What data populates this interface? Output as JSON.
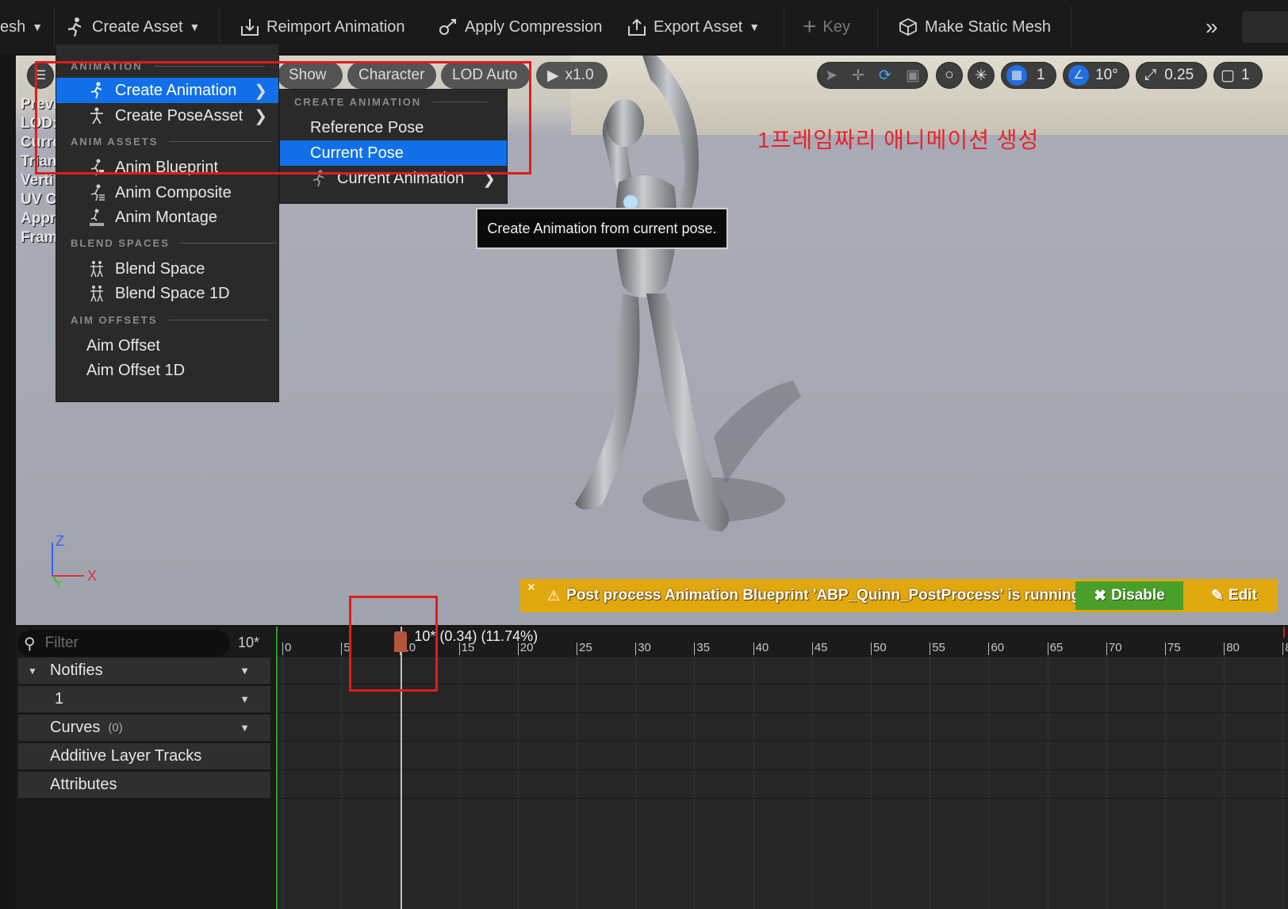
{
  "toolbar": {
    "mesh_label": "esh",
    "create_asset": "Create Asset",
    "reimport": "Reimport Animation",
    "apply_compression": "Apply Compression",
    "export_asset": "Export Asset",
    "key": "Key",
    "make_static_mesh": "Make Static Mesh"
  },
  "viewport": {
    "pills": {
      "show": "Show",
      "character": "Character",
      "lod": "LOD Auto",
      "speed": "x1.0"
    },
    "grid_value": "1",
    "angle_value": "10°",
    "scale_value": "0.25",
    "camera_value": "1",
    "stats": [
      "Previ",
      "LOD:",
      "Curre",
      "Trian",
      "Verti",
      "UV C",
      "Appr",
      "Fram"
    ],
    "annotation": "1프레임짜리 애니메이션 생성",
    "axis_z": "Z",
    "axis_x": "X",
    "axis_y": "Y"
  },
  "menu_main": {
    "section_animation": "ANIMATION",
    "create_animation": "Create Animation",
    "create_pose_asset": "Create PoseAsset",
    "section_anim_assets": "ANIM ASSETS",
    "anim_blueprint": "Anim Blueprint",
    "anim_composite": "Anim Composite",
    "anim_montage": "Anim Montage",
    "section_blend_spaces": "BLEND SPACES",
    "blend_space": "Blend Space",
    "blend_space_1d": "Blend Space 1D",
    "section_aim_offsets": "AIM OFFSETS",
    "aim_offset": "Aim Offset",
    "aim_offset_1d": "Aim Offset 1D"
  },
  "menu_sub": {
    "section": "CREATE ANIMATION",
    "reference_pose": "Reference Pose",
    "current_pose": "Current Pose",
    "current_animation": "Current Animation"
  },
  "tooltip": "Create Animation from current pose.",
  "warning": {
    "text": "Post process Animation Blueprint 'ABP_Quinn_PostProcess' is running.",
    "disable": "Disable",
    "edit": "Edit",
    "color": "#e1a80e"
  },
  "tracks": {
    "filter_placeholder": "Filter",
    "frame_value": "10*",
    "notifies": "Notifies",
    "notify_track": "1",
    "curves": "Curves",
    "curves_count": "(0)",
    "additive": "Additive Layer Tracks",
    "attributes": "Attributes"
  },
  "timeline": {
    "playhead_label": "10* (0.34) (11.74%)",
    "ticks": [
      "0",
      "5",
      "10",
      "15",
      "20",
      "25",
      "30",
      "35",
      "40",
      "45",
      "50",
      "55",
      "60",
      "65",
      "70",
      "75",
      "80",
      "8"
    ]
  }
}
